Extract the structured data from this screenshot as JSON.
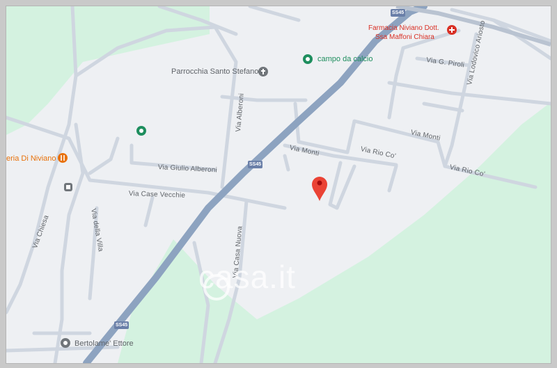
{
  "map": {
    "highway": {
      "name": "SS45"
    },
    "roads": [
      "Via Monti",
      "Via Rio Co'",
      "Via Monti",
      "Via Rio Co'",
      "Via Giulio Alberoni",
      "Via Case Vecchie",
      "Via Alberoni",
      "Via Chiesa",
      "Via della Villa",
      "Via Casa Nuova",
      "Via Lodovico Ariosto",
      "Via G. Piroli"
    ],
    "places": {
      "church": "Parrocchia Santo Stefano",
      "sports": "campo da calcio",
      "pharmacy_line1": "Farmacia Niviano Dott.",
      "pharmacy_line2": "Ssa Maffoni Chiara",
      "restaurant": "eria Di Niviano",
      "person": "Bertolame' Ettore"
    },
    "watermark": "casa.it",
    "colors": {
      "background": "#eef0f3",
      "park": "#d4f2e0",
      "road": "#cfd6e0",
      "highway": "#8da3c0",
      "pin": "#ea4335",
      "poi_green": "#1e8e5e",
      "poi_orange": "#e8710a",
      "poi_red": "#d93025",
      "poi_grey": "#70757a"
    },
    "icons": [
      "map-pin-icon",
      "church-icon",
      "sports-field-icon",
      "pharmacy-icon",
      "restaurant-icon",
      "bus-stop-icon",
      "place-icon",
      "person-place-icon"
    ]
  }
}
